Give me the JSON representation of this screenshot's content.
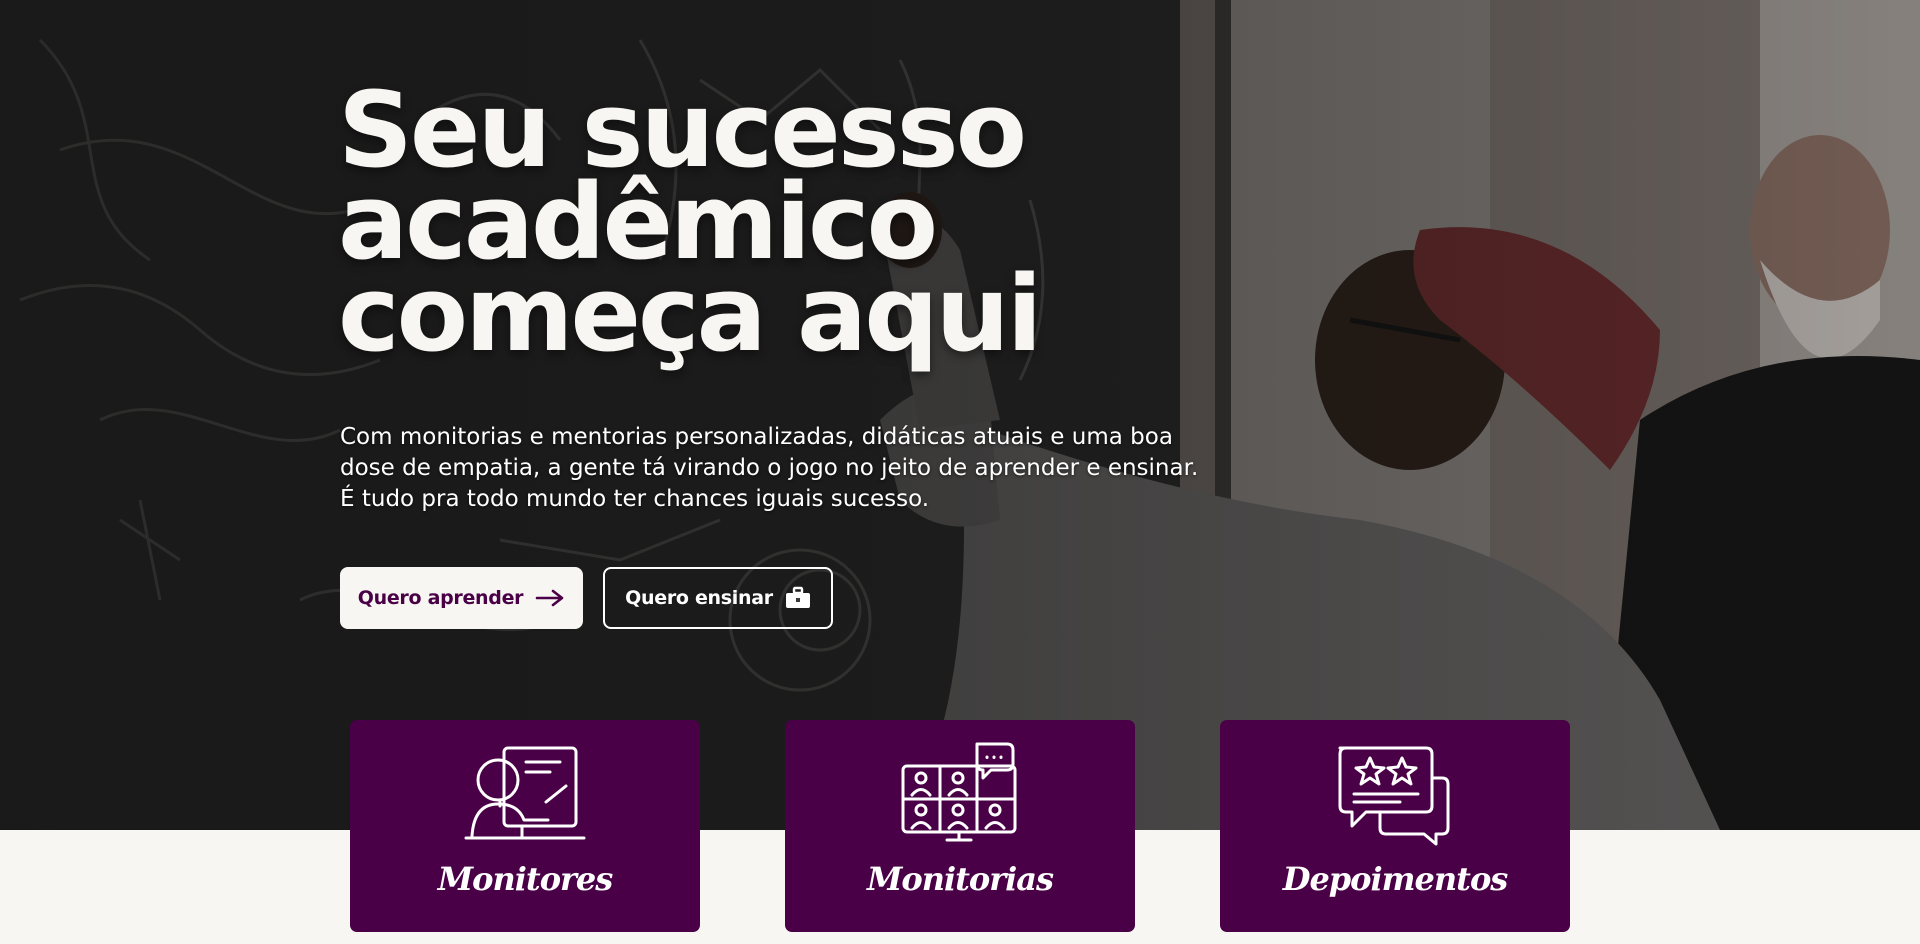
{
  "hero": {
    "headline_lines": [
      "Seu sucesso",
      "acadêmico",
      "começa aqui"
    ],
    "subtitle_lines": [
      "Com monitorias e mentorias personalizadas, didáticas atuais e uma boa",
      "dose de empatia, a gente tá virando o jogo no jeito de aprender e ensinar.",
      "É tudo pra todo mundo ter chances iguais sucesso."
    ],
    "primary_button": {
      "label": "Quero aprender",
      "icon": "arrow-right-icon"
    },
    "secondary_button": {
      "label": "Quero ensinar",
      "icon": "briefcase-icon"
    }
  },
  "cards": [
    {
      "label": "Monitores",
      "icon": "teacher-board-icon"
    },
    {
      "label": "Monitorias",
      "icon": "video-conference-icon"
    },
    {
      "label": "Depoimentos",
      "icon": "rating-chat-icon"
    }
  ],
  "colors": {
    "brand_purple": "#4a0047",
    "offwhite": "#f7f6f2",
    "text_white": "#ffffff"
  }
}
